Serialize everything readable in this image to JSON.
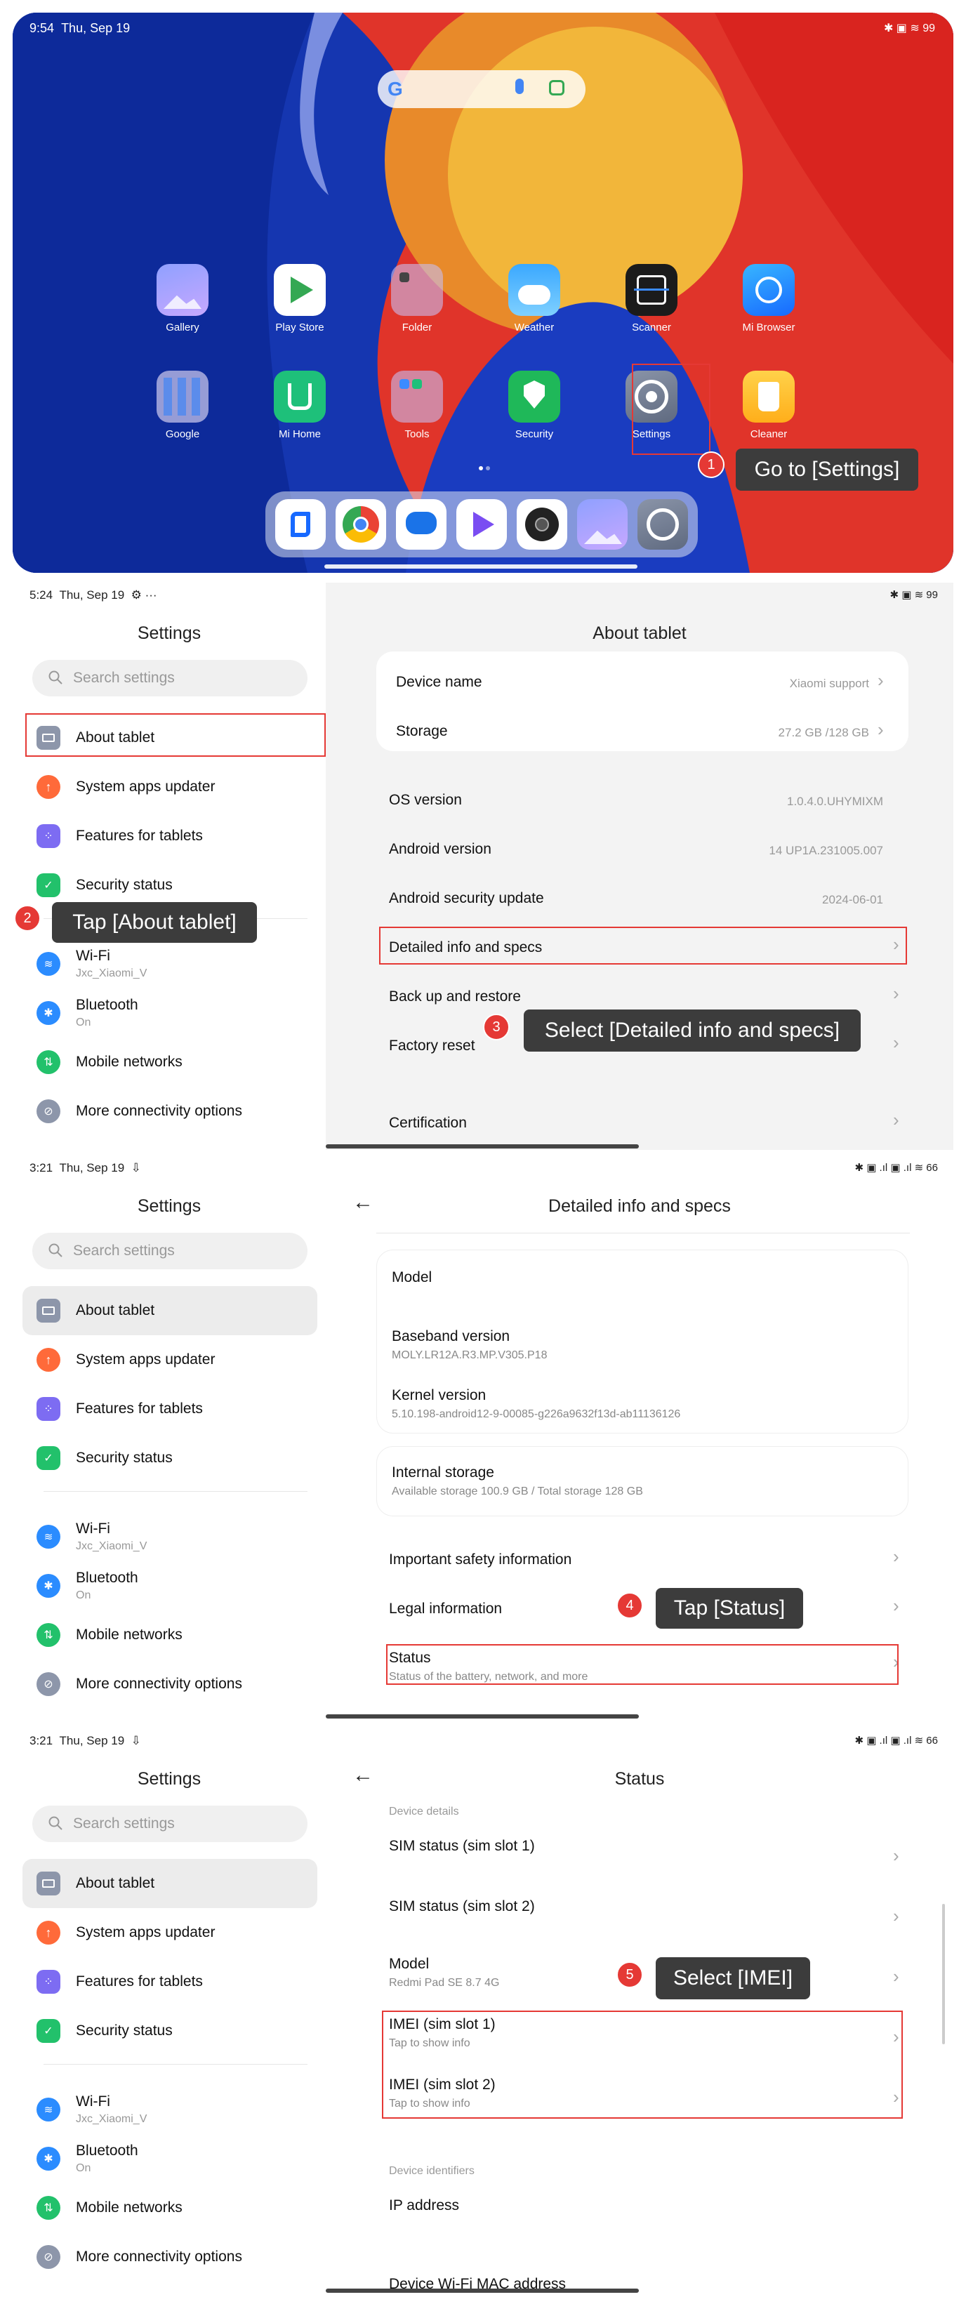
{
  "p1": {
    "time": "9:54",
    "date": "Thu, Sep 19",
    "status_icons": "✱ ▣ ≋ 99",
    "apps_row1": [
      "Gallery",
      "Play Store",
      "Folder",
      "Weather",
      "Scanner",
      "Mi Browser"
    ],
    "apps_row2": [
      "Google",
      "Mi Home",
      "Tools",
      "Security",
      "Settings",
      "Cleaner"
    ],
    "step": "1",
    "tip": "Go to [Settings]"
  },
  "nav": {
    "title": "Settings",
    "search_placeholder": "Search settings",
    "items": [
      {
        "label": "About tablet",
        "sub": ""
      },
      {
        "label": "System apps updater",
        "sub": ""
      },
      {
        "label": "Features for tablets",
        "sub": ""
      },
      {
        "label": "Security status",
        "sub": ""
      },
      {
        "label": "Wi-Fi",
        "sub": "Jxc_Xiaomi_V"
      },
      {
        "label": "Bluetooth",
        "sub": "On"
      },
      {
        "label": "Mobile networks",
        "sub": ""
      },
      {
        "label": "More connectivity options",
        "sub": ""
      }
    ]
  },
  "p2": {
    "time": "5:24",
    "date": "Thu, Sep 19",
    "extra": "⚙ ···",
    "status_icons": "✱ ▣ ≋ 99",
    "title": "About tablet",
    "device_name": "Device name",
    "device_value": "Xiaomi support",
    "storage": "Storage",
    "storage_value": "27.2 GB /128 GB",
    "os": "OS version",
    "os_value": "1.0.4.0.UHYMIXM",
    "android": "Android version",
    "android_value": "14 UP1A.231005.007",
    "security": "Android security update",
    "security_value": "2024-06-01",
    "detailed": "Detailed info and specs",
    "backup": "Back up and restore",
    "reset": "Factory reset",
    "cert": "Certification",
    "step2": "2",
    "tip2": "Tap [About tablet]",
    "step3": "3",
    "tip3": "Select [Detailed info and specs]"
  },
  "p3": {
    "time": "3:21",
    "date": "Thu, Sep 19",
    "extra": "⇩",
    "status_icons": "✱ ▣ .ıl ▣ .ıl ≋ 66",
    "title": "Detailed info and specs",
    "model": "Model",
    "baseband": "Baseband version",
    "baseband_value": "MOLY.LR12A.R3.MP.V305.P18",
    "kernel": "Kernel version",
    "kernel_value": "5.10.198-android12-9-00085-g226a9632f13d-ab11136126",
    "internal": "Internal storage",
    "internal_value": "Available storage  100.9 GB / Total storage  128 GB",
    "safety": "Important safety information",
    "legal": "Legal information",
    "status": "Status",
    "status_sub": "Status of the battery, network, and more",
    "step": "4",
    "tip": "Tap [Status]"
  },
  "p4": {
    "time": "3:21",
    "date": "Thu, Sep 19",
    "extra": "⇩",
    "status_icons": "✱ ▣ .ıl ▣ .ıl ≋ 66",
    "title": "Status",
    "device_details": "Device details",
    "sim1": "SIM status (sim slot 1)",
    "sim2": "SIM status (sim slot 2)",
    "model": "Model",
    "model_value": "Redmi Pad SE 8.7 4G",
    "imei1": "IMEI (sim slot 1)",
    "imei1_sub": "Tap to show info",
    "imei2": "IMEI (sim slot 2)",
    "imei2_sub": "Tap to show info",
    "identifiers": "Device identifiers",
    "ip": "IP address",
    "mac": "Device Wi-Fi MAC address",
    "step": "5",
    "tip": "Select [IMEI]"
  },
  "colors": {
    "accent_red": "#e53935",
    "tip_bg": "#3c3c3c"
  }
}
